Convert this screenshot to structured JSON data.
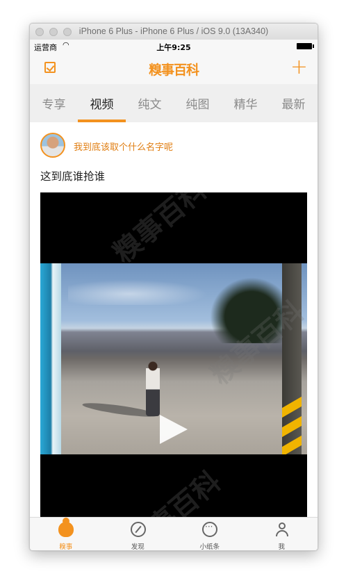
{
  "window": {
    "title": "iPhone 6 Plus - iPhone 6 Plus / iOS 9.0 (13A340)"
  },
  "statusbar": {
    "carrier": "运营商",
    "time": "上午9:25",
    "wifi_icon": "wifi-icon",
    "battery_icon": "battery-icon"
  },
  "navbar": {
    "logo": "糗事百科",
    "left_icon": "checkbox-edit-icon",
    "right_icon": "plus-icon",
    "right_label": "+"
  },
  "tabs": [
    {
      "label": "专享"
    },
    {
      "label": "视频"
    },
    {
      "label": "纯文"
    },
    {
      "label": "纯图"
    },
    {
      "label": "精华"
    },
    {
      "label": "最新"
    }
  ],
  "active_tab": "视频",
  "post": {
    "username": "我到底该取个什么名字呢",
    "text": "这到底谁抢谁",
    "video": {
      "play_icon": "play-icon",
      "watermark": "糗事百科"
    }
  },
  "tabbar": [
    {
      "label": "糗事",
      "icon": "poop-icon"
    },
    {
      "label": "发现",
      "icon": "compass-icon"
    },
    {
      "label": "小纸条",
      "icon": "chat-bubble-icon"
    },
    {
      "label": "我",
      "icon": "user-icon"
    }
  ],
  "colors": {
    "accent": "#f3921f",
    "tab_inactive": "#8a8a8a",
    "background": "#ffffff"
  }
}
